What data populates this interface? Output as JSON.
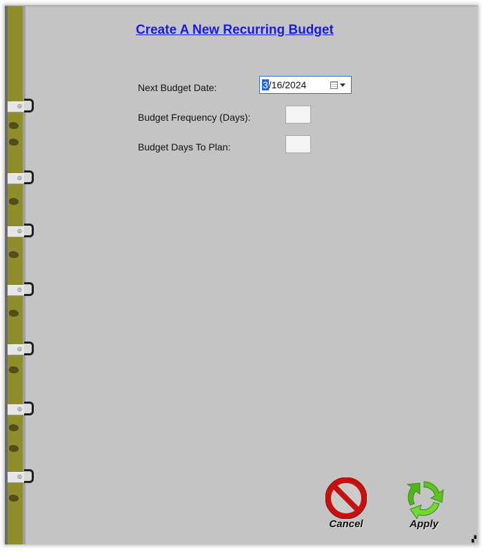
{
  "form": {
    "title": "Create A New Recurring Budget",
    "next_budget_date_label": "Next Budget Date:",
    "next_budget_date_month": "3",
    "next_budget_date_rest": "/16/2024",
    "frequency_label": "Budget Frequency (Days):",
    "frequency_value": "",
    "days_to_plan_label": "Budget Days To Plan:",
    "days_to_plan_value": ""
  },
  "actions": {
    "cancel_label": "Cancel",
    "apply_label": "Apply"
  },
  "icons": {
    "calendar": "calendar-icon",
    "dropdown": "chevron-down-icon",
    "cancel": "no-entry-icon",
    "apply": "recycle-arrows-icon",
    "binding": "spiral-ring-icon"
  },
  "colors": {
    "background": "#c4c4c4",
    "title": "#1a1ae6",
    "binding": "#8f8d2c",
    "cancel": "#d21414",
    "apply": "#6ad02a",
    "selection": "#2a62d8"
  }
}
